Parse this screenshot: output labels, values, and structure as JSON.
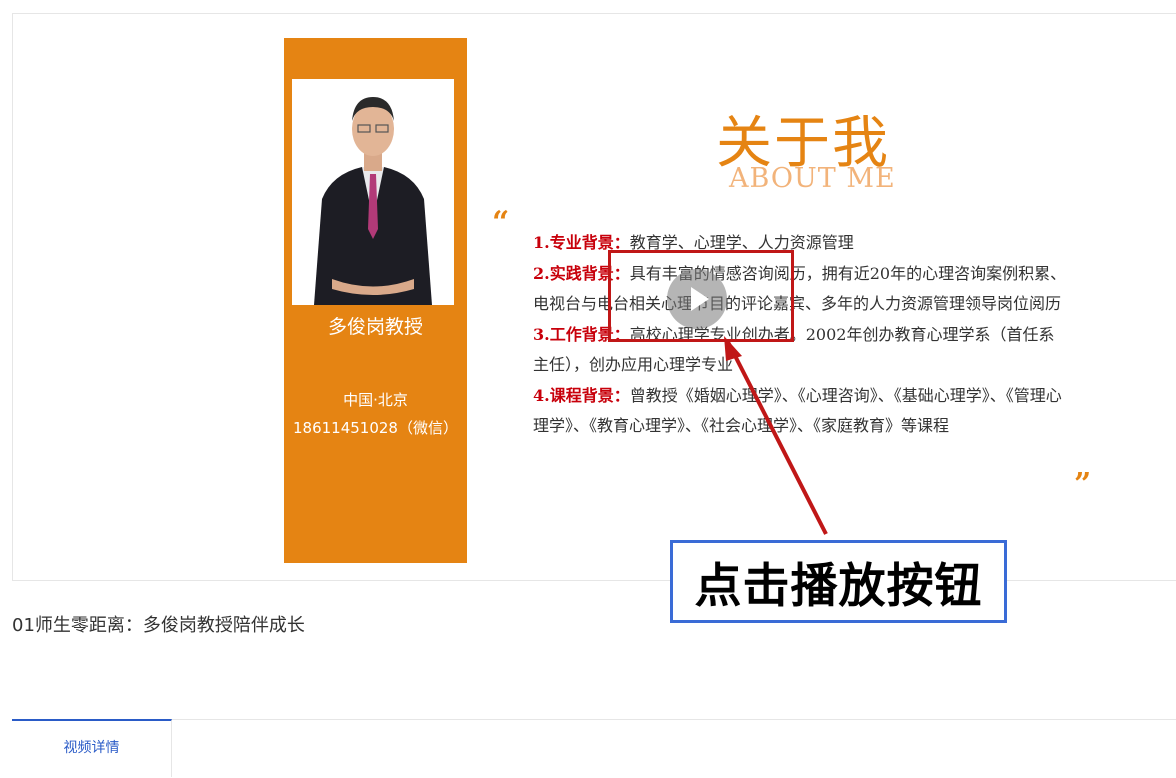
{
  "profile": {
    "name": "多俊岗教授",
    "location": "中国·北京",
    "phone": "18611451028（微信）"
  },
  "about": {
    "title": "关于我",
    "subtitle": "ABOUT ME",
    "quote_open": "“",
    "quote_close": "”",
    "items": [
      {
        "label": "1.专业背景：",
        "text": "教育学、心理学、人力资源管理"
      },
      {
        "label": "2.实践背景：",
        "text": "具有丰富的情感咨询阅历，拥有近20年的心理咨询案例积累、电视台与电台相关心理节目的评论嘉宾、多年的人力资源管理领导岗位阅历"
      },
      {
        "label": "3.工作背景：",
        "text": "高校心理学专业创办者。2002年创办教育心理学系（首任系主任），创办应用心理学专业"
      },
      {
        "label": "4.课程背景：",
        "text": "曾教授《婚姻心理学》、《心理咨询》、《基础心理学》、《管理心理学》、《教育心理学》、《社会心理学》、《家庭教育》等课程"
      }
    ]
  },
  "annotation": {
    "callout_text": "点击播放按钮"
  },
  "video": {
    "title": "01师生零距离：多俊岗教授陪伴成长"
  },
  "tabs": [
    {
      "label": "视频详情",
      "active": true
    }
  ],
  "colors": {
    "accent_orange": "#e58413",
    "label_red": "#c8000b",
    "annotation_red": "#c01717",
    "annotation_blue": "#3a6bd6",
    "tab_blue": "#2a5bc7"
  }
}
